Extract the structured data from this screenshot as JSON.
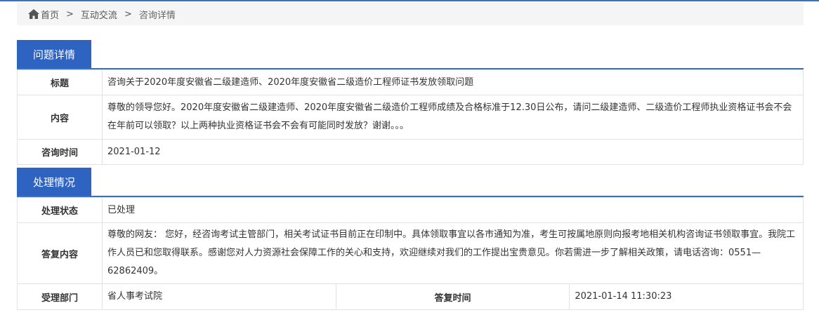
{
  "breadcrumb": {
    "home": "首页",
    "sep1": ">",
    "item1": "互动交流",
    "sep2": ">",
    "current": "咨询详情"
  },
  "question": {
    "tab": "问题详情",
    "title_label": "标题",
    "title_value": "咨询关于2020年度安徽省二级建造师、2020年度安徽省二级造价工程师证书发放领取问题",
    "content_label": "内容",
    "content_value": "尊敬的领导您好。2020年度安徽省二级建造师、2020年度安徽省二级造价工程师成绩及合格标准于12.30日公布，请问二级建造师、二级造价工程师执业资格证书会不会在年前可以领取？以上两种执业资格证书会不会有可能同时发放？谢谢。。。",
    "time_label": "咨询时间",
    "time_value": "2021-01-12"
  },
  "handling": {
    "tab": "处理情况",
    "status_label": "处理状态",
    "status_value": "已处理",
    "reply_label": "答复内容",
    "reply_value": "尊敬的网友： 您好，经咨询考试主管部门，相关考试证书目前正在印制中。具体领取事宜以各市通知为准，考生可按属地原则向报考地相关机构咨询证书领取事宜。我院工作人员已和您取得联系。感谢您对人力资源社会保障工作的关心和支持，欢迎继续对我们的工作提出宝贵意见。你若需进一步了解相关政策，请电话咨询：0551—62862409。",
    "dept_label": "受理部门",
    "dept_value": "省人事考试院",
    "reply_time_label": "答复时间",
    "reply_time_value": "2021-01-14 11:30:23"
  }
}
